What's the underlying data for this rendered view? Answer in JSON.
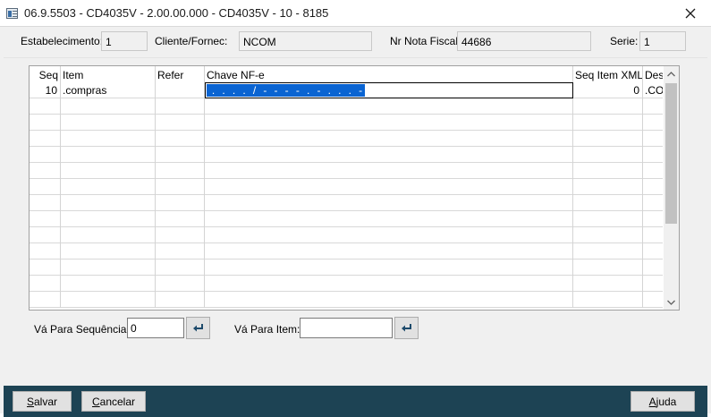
{
  "window": {
    "title": "06.9.5503 - CD4035V - 2.00.00.000 - CD4035V - 10 - 8185"
  },
  "header": {
    "estabelecimento_label": "Estabelecimento:",
    "estabelecimento_value": "1",
    "cliente_label": "Cliente/Fornec:",
    "cliente_value": "NCOM",
    "nota_label": "Nr Nota Fiscal:",
    "nota_value": "44686",
    "serie_label": "Serie:",
    "serie_value": "1"
  },
  "grid": {
    "columns": [
      "Seq",
      "Item",
      "Refer",
      "Chave NF-e",
      "Seq Item XML",
      "Des"
    ],
    "rows": [
      {
        "seq": "10",
        "item": ".compras",
        "refer": "",
        "chave": " .  .  .  .  /  -  -  -  -  .  -  .  .  .  -",
        "seq_item_xml": "0",
        "des": ".CO"
      }
    ],
    "empty_row_count": 13
  },
  "goto": {
    "sequencia_label": "Vá Para Sequência:",
    "sequencia_value": "0",
    "item_label": "Vá Para Item:",
    "item_value": ""
  },
  "buttons": {
    "salvar_key": "S",
    "salvar_rest": "alvar",
    "cancelar_key": "C",
    "cancelar_rest": "ancelar",
    "ajuda_key": "A",
    "ajuda_rest": "juda"
  },
  "colors": {
    "bottom_bar": "#1d4354",
    "selection": "#0a64d2",
    "window_bg": "#f0f0f0"
  }
}
